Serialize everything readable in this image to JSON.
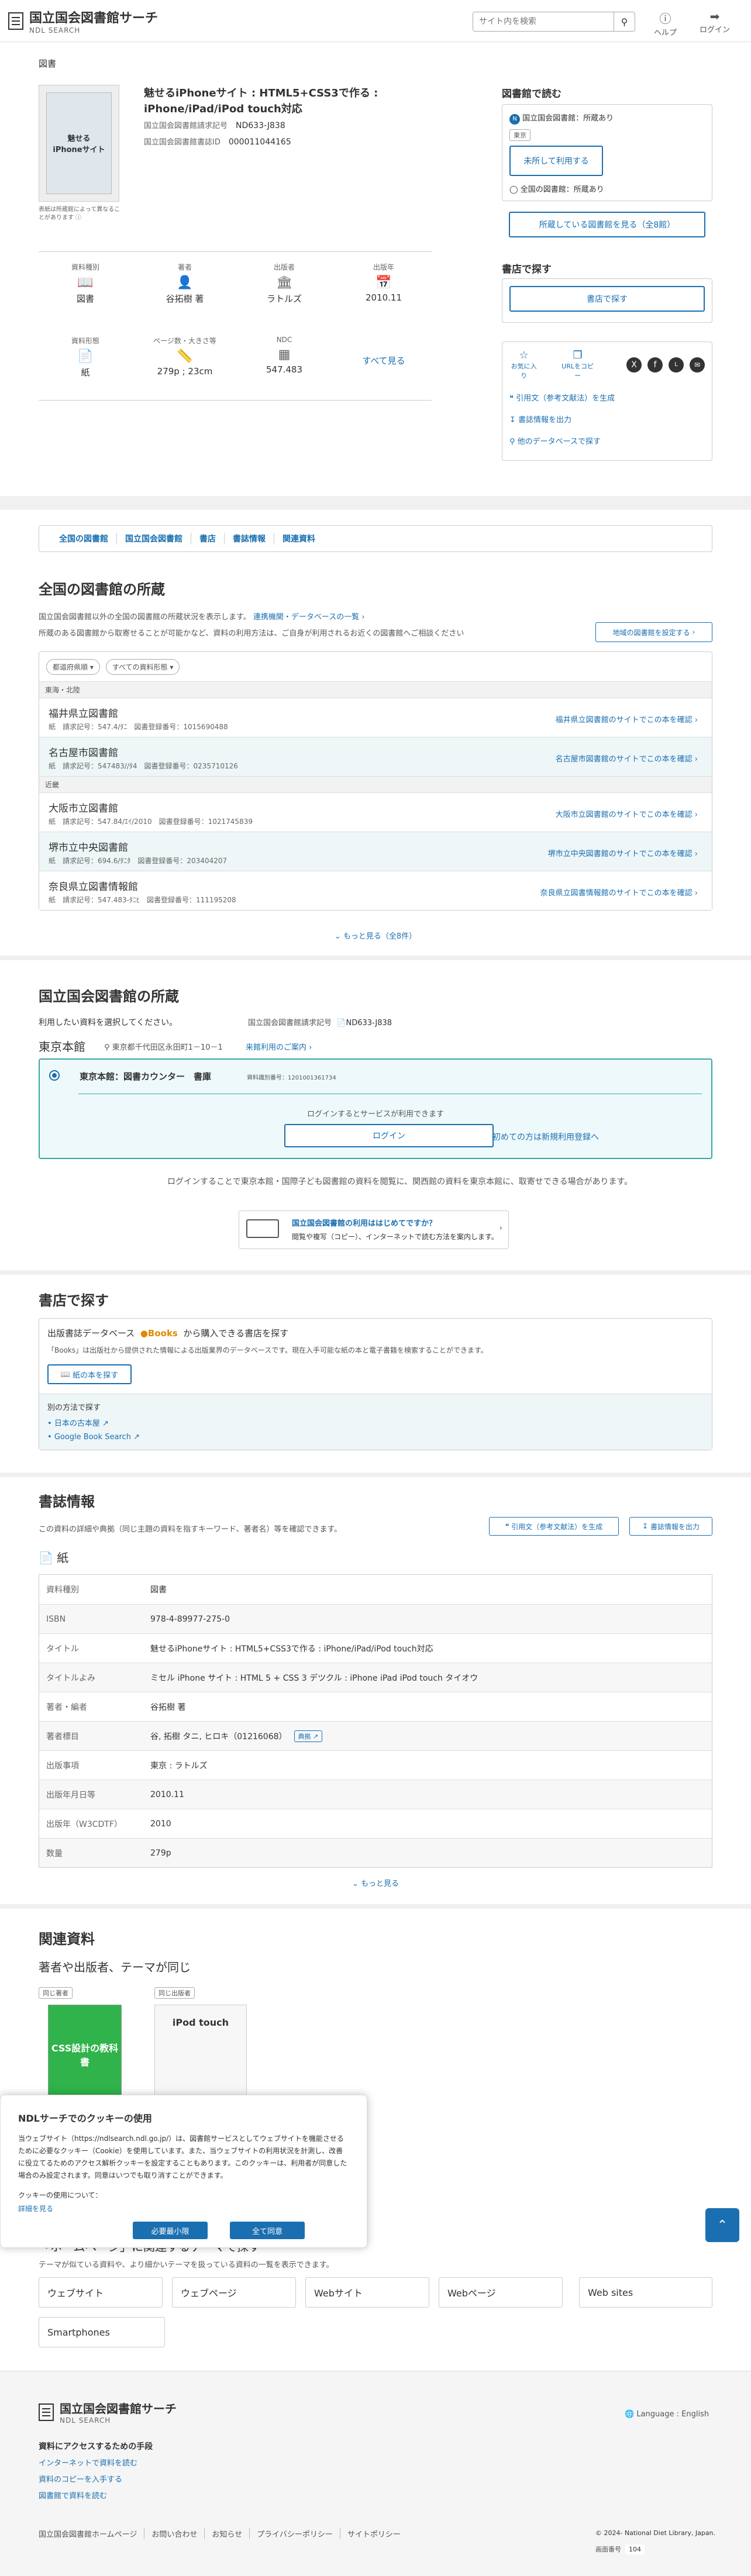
{
  "header": {
    "logo_main": "国立国会図書館サーチ",
    "logo_sub": "NDL SEARCH",
    "search_placeholder": "サイト内を検索",
    "help": "ヘルプ",
    "login": "ログイン"
  },
  "breadcrumb": "図書",
  "book": {
    "cover_line1": "魅せる",
    "cover_line2": "iPhoneサイト",
    "cover_note": "表紙は所蔵館によって異なることがあります",
    "title": "魅せるiPhoneサイト : HTML5+CSS3で作る : iPhone/iPad/iPod touch対応",
    "call_label": "国立国会図書館請求記号",
    "call_value": "ND633-J838",
    "bib_label": "国立国会図書館書誌ID",
    "bib_value": "000011044165"
  },
  "facts": [
    {
      "label": "資料種別",
      "icon": "book-icon",
      "value": "図書"
    },
    {
      "label": "著者",
      "icon": "person-icon",
      "value": "谷拓樹 著"
    },
    {
      "label": "出版者",
      "icon": "building-icon",
      "value": "ラトルズ"
    },
    {
      "label": "出版年",
      "icon": "calendar-icon",
      "value": "2010.11"
    },
    {
      "label": "資料形態",
      "icon": "document-icon",
      "value": "紙"
    },
    {
      "label": "ページ数・大きさ等",
      "icon": "ruler-icon",
      "value": "279p ; 23cm"
    },
    {
      "label": "NDC",
      "icon": "grid-icon",
      "value": "547.483"
    }
  ],
  "see_all": "すべて見る",
  "side": {
    "read_title": "図書館で読む",
    "ndl_holding": "国立国会図書館：所蔵あり",
    "tokyo_tag": "東京",
    "not_login": "未所して利用する",
    "national_holding": "全国の図書館：所蔵あり",
    "view_holdings": "所蔵している図書館を見る（全8館）",
    "shop_title": "書店で探す",
    "shop_btn": "書店で探す",
    "favorite": "お気に入り",
    "url_copy": "URLをコピー",
    "citation": "引用文（参考文献法）を生成",
    "export": "書誌情報を出力",
    "other_db": "他のデータベースで探す"
  },
  "tabs": [
    "全国の図書館",
    "国立国会図書館",
    "書店",
    "書誌情報",
    "関連資料"
  ],
  "holdings": {
    "title": "全国の図書館の所蔵",
    "desc1": "国立国会図書館以外の全国の図書館の所蔵状況を表示します。",
    "desc1_link": "連携機関・データベースの一覧",
    "desc2": "所蔵のある図書館から取寄せることが可能かなど、資料の利用方法は、ご自身が利用されるお近くの図書館へご相談ください",
    "region_btn": "地域の図書館を設定する",
    "filter1": "都道府県順",
    "filter2": "すべての資料形態",
    "region1": "東海・北陸",
    "region2": "近畿",
    "libs": [
      {
        "name": "福井県立図書館",
        "sub": "紙　請求記号：547.4/ﾀﾆ　図書登録番号：1015690488",
        "link": "福井県立図書館のサイトでこの本を確認"
      },
      {
        "name": "名古屋市図書館",
        "sub": "紙　請求記号：547483//ﾀ4　図書登録番号：0235710126",
        "link": "名古屋市図書館のサイトでこの本を確認"
      },
      {
        "name": "大阪市立図書館",
        "sub": "紙　請求記号：547.84/ｴｲ/2010　図書登録番号：1021745839",
        "link": "大阪市立図書館のサイトでこの本を確認"
      },
      {
        "name": "堺市立中央図書館",
        "sub": "紙　請求記号：694.6/ﾀﾆﾀ　図書登録番号：203404207",
        "link": "堺市立中央図書館のサイトでこの本を確認"
      },
      {
        "name": "奈良県立図書情報館",
        "sub": "紙　請求記号：547.483-ﾀﾆﾋ　図書登録番号：111195208",
        "link": "奈良県立図書情報館のサイトでこの本を確認"
      }
    ],
    "more": "もっと見る（全8件）"
  },
  "ndl": {
    "title": "国立国会図書館の所蔵",
    "select_text": "利用したい資料を選択してください。",
    "call_label": "国立国会図書館請求記号",
    "call_value": "ND633-J838",
    "branch": "東京本館",
    "address": "東京都千代田区永田町1－10－1",
    "guide": "来館利用のご案内",
    "item_name": "東京本館：図書カウンター　書庫",
    "item_id": "資料識別番号：1201001361734",
    "login_needed": "ログインするとサービスが利用できます",
    "login_btn": "ログイン",
    "register": "初めての方は新規利用登録へ",
    "note": "ログインすることで東京本館・国際子ども図書館の資料を閲覧に、関西館の資料を東京本館に、取寄せできる場合があります。",
    "help_title": "国立国会図書館の利用ははじめてですか？",
    "help_sub": "閲覧や複写（コピー）、インターネットで読む方法を案内します。"
  },
  "bookstore": {
    "title": "書店で探す",
    "db_text": "出版書誌データベース",
    "books_brand": "Books",
    "db_text2": "から購入できる書店を探す",
    "desc": "「Books」は出版社から提供された情報による出版業界のデータベースです。現在入手可能な紙の本と電子書籍を検索することができます。",
    "btn": "紙の本を探す",
    "other": "別の方法で探す",
    "link1": "日本の古本屋",
    "link2": "Google Book Search"
  },
  "biblio": {
    "title": "書誌情報",
    "desc": "この資料の詳細や典拠（同じ主題の資料を指すキーワード、著者名）等を確認できます。",
    "cite_btn": "引用文（参考文献法）を生成",
    "export_btn": "書誌情報を出力",
    "form": "紙",
    "rows": [
      {
        "k": "資料種別",
        "v": "図書"
      },
      {
        "k": "ISBN",
        "v": "978-4-89977-275-0"
      },
      {
        "k": "タイトル",
        "v": "魅せるiPhoneサイト : HTML5+CSS3で作る : iPhone/iPad/iPod touch対応"
      },
      {
        "k": "タイトルよみ",
        "v": "ミセル iPhone サイト : HTML 5 + CSS 3 デツクル : iPhone iPad iPod touch タイオウ"
      },
      {
        "k": "著者・編者",
        "v": "谷拓樹 著"
      },
      {
        "k": "著者標目",
        "v": "谷, 拓樹 タニ, ヒロキ（01216068）"
      },
      {
        "k": "出版事項",
        "v": "東京 : ラトルズ"
      },
      {
        "k": "出版年月日等",
        "v": "2010.11"
      },
      {
        "k": "出版年（W3CDTF）",
        "v": "2010"
      },
      {
        "k": "数量",
        "v": "279p"
      }
    ],
    "authority": "典拠",
    "more": "もっと見る"
  },
  "related": {
    "title": "関連資料",
    "sub": "著者や出版者、テーマが同じ",
    "tag1": "同じ著者",
    "tag2": "同じ出版者",
    "book1": "CSS設計の教科書",
    "book2": "iPod touch",
    "homepage_title": "「ホームページ」に関連するテーマで探す",
    "homepage_desc": "テーマが似ている資料や、より細かいテーマを扱っている資料の一覧を表示できます。",
    "chips": [
      "ウェブサイト",
      "ウェブページ",
      "Webサイト",
      "Webページ",
      "Web sites",
      "Smartphones"
    ]
  },
  "cookie": {
    "title": "NDLサーチでのクッキーの使用",
    "body": "当ウェブサイト（https://ndlsearch.ndl.go.jp/）は、図書館サービスとしてウェブサイトを機能させるために必要なクッキー（Cookie）を使用しています。また、当ウェブサイトの利用状況を計測し、改善に役立てるためのアクセス解析クッキーを設定することもあります。このクッキーは、利用者が同意した場合のみ設定されます。同意はいつでも取り消すことができます。",
    "about": "クッキーの使用について：",
    "detail": "詳細を見る",
    "necessary": "必要最小限",
    "accept": "全て同意"
  },
  "footer": {
    "logo_main": "国立国会図書館サーチ",
    "logo_sub": "NDL SEARCH",
    "language": "Language : English",
    "access_title": "資料にアクセスするための手段",
    "links": [
      "インターネットで資料を読む",
      "資料のコピーを入手する",
      "図書館で資料を読む"
    ],
    "bottom": [
      "国立国会図書館ホームページ",
      "お問い合わせ",
      "お知らせ",
      "プライバシーポリシー",
      "サイトポリシー"
    ],
    "copyright": "© 2024- National Diet Library, Japan.",
    "page_label": "画面番号",
    "page_num": "104"
  }
}
